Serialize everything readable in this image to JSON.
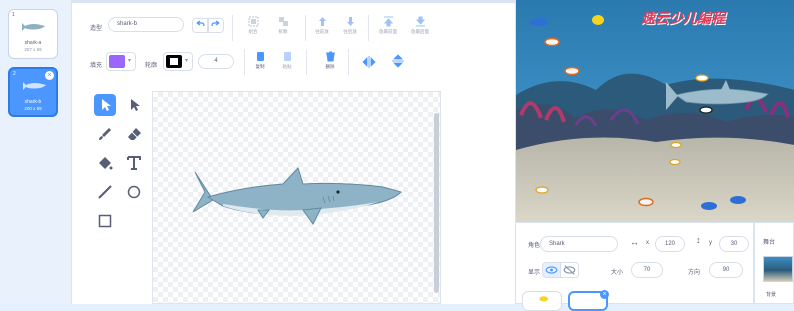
{
  "costumes": [
    {
      "number": "1",
      "name": "shark-a",
      "size": "207 x 59"
    },
    {
      "number": "2",
      "name": "shark-b",
      "size": "200 x 59"
    }
  ],
  "editor": {
    "costume_label": "造型",
    "costume_name": "shark-b",
    "group_label": "组合",
    "ungroup_label": "拆散",
    "forward_label": "往前放",
    "backward_label": "往后放",
    "front_label": "放最前面",
    "back_label": "放最后面",
    "fill_label": "填充",
    "outline_label": "轮廓",
    "outline_width": "4",
    "copy_label": "复制",
    "paste_label": "粘贴",
    "delete_label": "删除",
    "fill_color": "#9966ff",
    "outline_color": "#000000"
  },
  "stage": {
    "logo_text": "速云少儿编程"
  },
  "sprite_info": {
    "sprite_label": "角色",
    "sprite_name": "Shark",
    "x_label": "x",
    "x_value": "120",
    "y_label": "y",
    "y_value": "30",
    "show_label": "显示",
    "size_label": "大小",
    "size_value": "70",
    "direction_label": "方向",
    "direction_value": "90"
  },
  "stage_pane": {
    "title": "舞台",
    "backdrop_label": "背景"
  },
  "colors": {
    "accent": "#4c97ff",
    "panel_bg": "#e9f1fc"
  }
}
